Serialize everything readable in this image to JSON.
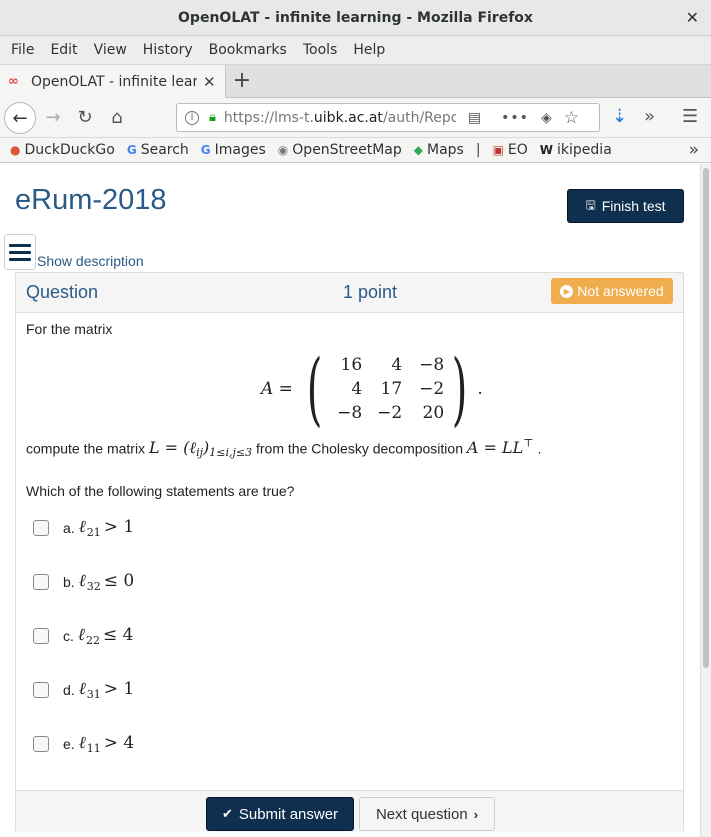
{
  "window": {
    "title": "OpenOLAT - infinite learning - Mozilla Firefox",
    "close_icon": "✕"
  },
  "menubar": [
    "File",
    "Edit",
    "View",
    "History",
    "Bookmarks",
    "Tools",
    "Help"
  ],
  "tab": {
    "title": "OpenOLAT - infinite learning - Mozilla Firefox",
    "favicon": "∞",
    "close": "✕"
  },
  "newtab_label": "+",
  "navbar": {
    "url_prefix": "https://lms-t.",
    "url_domain": "uibk.ac.at",
    "url_path": "/auth/Repo"
  },
  "bookmarks": {
    "items": [
      {
        "label": "DuckDuckGo",
        "icon": "duckduckgo-icon",
        "glyph": "●",
        "color": "#de5833"
      },
      {
        "label": "Search",
        "icon": "google-icon",
        "glyph": "G",
        "color": "#4285f4"
      },
      {
        "label": "Images",
        "icon": "google-icon",
        "glyph": "G",
        "color": "#4285f4"
      },
      {
        "label": "OpenStreetMap",
        "icon": "osm-icon",
        "glyph": "◉",
        "color": "#7a7a7a"
      },
      {
        "label": "Maps",
        "icon": "maps-icon",
        "glyph": "◆",
        "color": "#34a853"
      },
      {
        "label": "EO",
        "icon": "eo-icon",
        "glyph": "▣",
        "color": "#c0392b"
      },
      {
        "label": "ikipedia",
        "icon": "wikipedia-icon",
        "glyph": "W",
        "color": "#222222"
      }
    ],
    "separator": "|",
    "more": "»"
  },
  "page": {
    "title": "eRum-2018",
    "finish_label": "Finish test",
    "show_description": "Show description"
  },
  "question": {
    "label": "Question",
    "points": "1 point",
    "status": "Not answered",
    "status_color": "#f0ad4e",
    "intro": "For the matrix",
    "matrix_lhs": "A =",
    "matrix": [
      [
        "16",
        "4",
        "−8"
      ],
      [
        "4",
        "17",
        "−2"
      ],
      [
        "−8",
        "−2",
        "20"
      ]
    ],
    "compute_pre": "compute the matrix",
    "compute_math1": "L = (ℓ",
    "compute_sub1": "ij",
    "compute_math2": ")",
    "compute_sub2": "1≤i,j≤3",
    "compute_mid": "from the Cholesky decomposition",
    "compute_math3": "A = LL",
    "compute_sup": "⊤",
    "compute_end": ".",
    "prompt": "Which of the following statements are true?",
    "options": [
      {
        "letter": "a.",
        "ell": "ℓ",
        "sub": "21",
        "rel": "> 1"
      },
      {
        "letter": "b.",
        "ell": "ℓ",
        "sub": "32",
        "rel": "≤ 0"
      },
      {
        "letter": "c.",
        "ell": "ℓ",
        "sub": "22",
        "rel": "≤ 4"
      },
      {
        "letter": "d.",
        "ell": "ℓ",
        "sub": "31",
        "rel": "> 1"
      },
      {
        "letter": "e.",
        "ell": "ℓ",
        "sub": "11",
        "rel": "> 4"
      }
    ],
    "submit_label": "Submit answer",
    "next_label": "Next question"
  }
}
